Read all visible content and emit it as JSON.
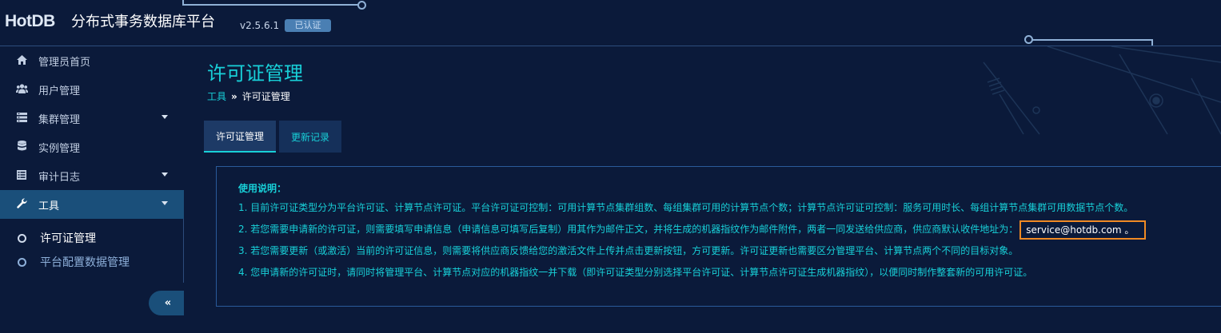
{
  "header": {
    "logo_text": "HotDB",
    "app_title": "分布式事务数据库平台",
    "version": "v2.5.6.1",
    "status_badge": "已认证"
  },
  "sidebar": {
    "items": [
      {
        "label": "管理员首页",
        "icon": "home-icon"
      },
      {
        "label": "用户管理",
        "icon": "users-icon"
      },
      {
        "label": "集群管理",
        "icon": "server-icon"
      },
      {
        "label": "实例管理",
        "icon": "database-icon"
      },
      {
        "label": "审计日志",
        "icon": "list-alt-icon"
      },
      {
        "label": "工具",
        "icon": "wrench-icon"
      }
    ],
    "tool_submenu": [
      {
        "label": "许可证管理"
      },
      {
        "label": "平台配置数据管理"
      }
    ],
    "collapse_label": "«"
  },
  "main": {
    "page_title": "许可证管理",
    "breadcrumb": {
      "root": "工具",
      "separator": "»",
      "current": "许可证管理"
    },
    "tabs": [
      {
        "label": "许可证管理"
      },
      {
        "label": "更新记录"
      }
    ],
    "instructions": {
      "heading": "使用说明：",
      "line1": "1. 目前许可证类型分为平台许可证、计算节点许可证。平台许可证可控制：可用计算节点集群组数、每组集群可用的计算节点个数；计算节点许可证可控制：服务可用时长、每组计算节点集群可用数据节点个数。",
      "line2_prefix": "2. 若您需要申请新的许可证，则需要填写申请信息（申请信息可填写后复制）用其作为邮件正文，并将生成的机器指纹作为邮件附件，两者一同发送给供应商，供应商默认收件地址为：",
      "email": "service@hotdb.com 。",
      "line3": "3. 若您需要更新（或激活）当前的许可证信息，则需要将供应商反馈给您的激活文件上传并点击更新按钮，方可更新。许可证更新也需要区分管理平台、计算节点两个不同的目标对象。",
      "line4": "4. 您申请新的许可证时，请同时将管理平台、计算节点对应的机器指纹一并下载（即许可证类型分别选择平台许可证、计算节点许可证生成机器指纹），以便同时制作整套新的可用许可证。"
    }
  }
}
